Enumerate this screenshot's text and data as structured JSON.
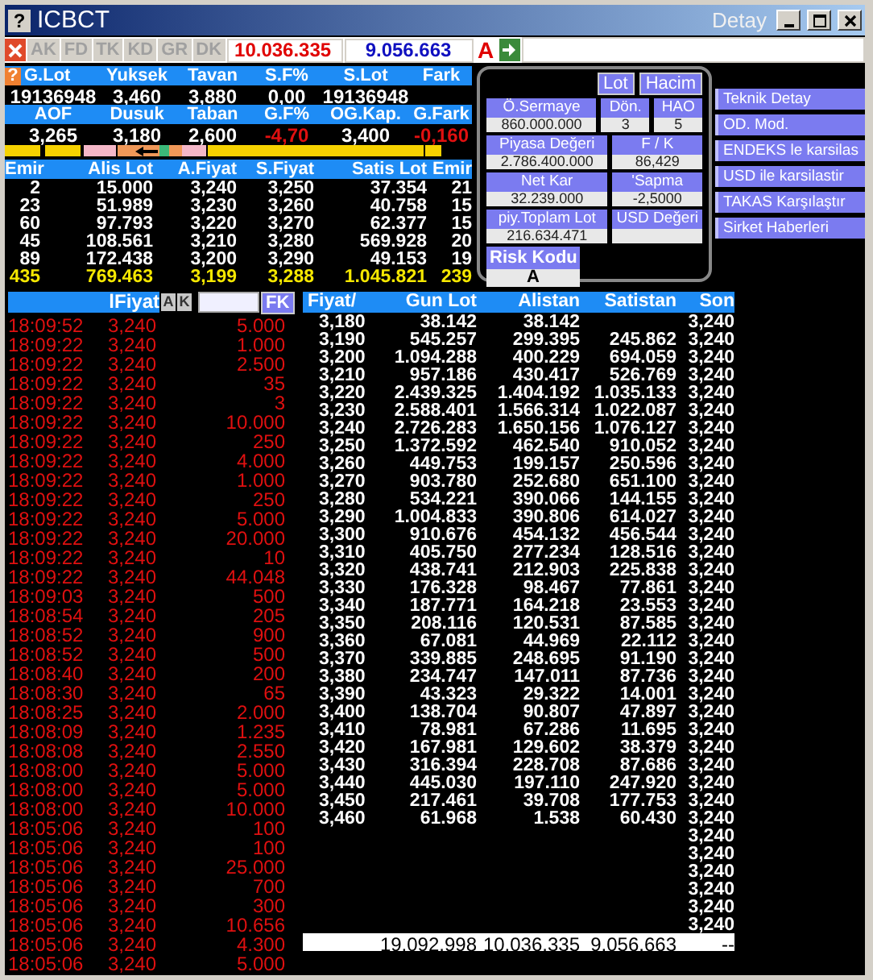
{
  "window": {
    "help": "?",
    "title": "ICBCT",
    "detay": "Detay"
  },
  "toolbar": {
    "tabs": [
      "AK",
      "FD",
      "TK",
      "KD",
      "GR",
      "DK"
    ],
    "buy_total": "10.036.335",
    "sell_total": "9.056.663",
    "flag": "A"
  },
  "summary": {
    "help": "?",
    "blocks": [
      {
        "headers": [
          "G.Lot",
          "Yuksek",
          "Tavan",
          "S.F%",
          "S.Lot",
          "Fark"
        ],
        "values": [
          {
            "text": "19136948",
            "negative": false
          },
          {
            "text": "3,460",
            "negative": false
          },
          {
            "text": "3,880",
            "negative": false
          },
          {
            "text": "0,00",
            "negative": false
          },
          {
            "text": "19136948",
            "negative": false
          }
        ]
      },
      {
        "headers": [
          "AOF",
          "Dusuk",
          "Taban",
          "G.F%",
          "OG.Kap.",
          "G.Fark"
        ],
        "values": [
          {
            "text": "3,265",
            "negative": false
          },
          {
            "text": "3,180",
            "negative": false
          },
          {
            "text": "2,600",
            "negative": false
          },
          {
            "text": "-4,70",
            "negative": true
          },
          {
            "text": "3,400",
            "negative": false
          },
          {
            "text": "-0,160",
            "negative": true
          }
        ]
      }
    ]
  },
  "depth": {
    "columns": [
      "Emir",
      "Alis Lot",
      "A.Fiyat",
      "S.Fiyat",
      "Satis Lot",
      "Emir"
    ],
    "rows": [
      [
        "2",
        "15.000",
        "3,240",
        "3,250",
        "37.354",
        "21"
      ],
      [
        "23",
        "51.989",
        "3,230",
        "3,260",
        "40.758",
        "15"
      ],
      [
        "60",
        "97.793",
        "3,220",
        "3,270",
        "62.377",
        "15"
      ],
      [
        "45",
        "108.561",
        "3,210",
        "3,280",
        "569.928",
        "20"
      ],
      [
        "89",
        "172.438",
        "3,200",
        "3,290",
        "49.153",
        "19"
      ]
    ],
    "total": [
      "435",
      "769.463",
      "3,199",
      "3,288",
      "1.045.821",
      "239"
    ]
  },
  "info_panel": {
    "toggles": [
      "Lot",
      "Hacim"
    ],
    "rows": [
      [
        {
          "label": "Ö.Sermaye",
          "value": "860.000.000"
        },
        {
          "label": "Dön.",
          "value": "3"
        },
        {
          "label": "HAO",
          "value": "5"
        }
      ],
      [
        {
          "label": "Piyasa Değeri",
          "value": "2.786.400.000"
        },
        {
          "label": "F / K",
          "value": "86,429"
        }
      ],
      [
        {
          "label": "Net Kar",
          "value": "32.239.000"
        },
        {
          "label": "'Sapma",
          "value": "-2,5000"
        }
      ],
      [
        {
          "label": "piy.Toplam Lot",
          "value": "216.634.471"
        },
        {
          "label": "USD Değeri"
        }
      ]
    ],
    "risk": {
      "label": "Risk Kodu",
      "value": "A"
    }
  },
  "actions": [
    "Teknik Detay",
    "OD. Mod.",
    "ENDEKS le karsilas",
    "USD ile karsilastir",
    "TAKAS Karşılaştır",
    "Sirket Haberleri"
  ],
  "trades": {
    "header": "lFiyat",
    "buttons": [
      "A",
      "K"
    ],
    "filter_button": "FK",
    "rows": [
      [
        "18:09:52",
        "3,240",
        "5.000"
      ],
      [
        "18:09:22",
        "3,240",
        "1.000"
      ],
      [
        "18:09:22",
        "3,240",
        "2.500"
      ],
      [
        "18:09:22",
        "3,240",
        "35"
      ],
      [
        "18:09:22",
        "3,240",
        "3"
      ],
      [
        "18:09:22",
        "3,240",
        "10.000"
      ],
      [
        "18:09:22",
        "3,240",
        "250"
      ],
      [
        "18:09:22",
        "3,240",
        "4.000"
      ],
      [
        "18:09:22",
        "3,240",
        "1.000"
      ],
      [
        "18:09:22",
        "3,240",
        "250"
      ],
      [
        "18:09:22",
        "3,240",
        "5.000"
      ],
      [
        "18:09:22",
        "3,240",
        "20.000"
      ],
      [
        "18:09:22",
        "3,240",
        "10"
      ],
      [
        "18:09:22",
        "3,240",
        "44.048"
      ],
      [
        "18:09:03",
        "3,240",
        "500"
      ],
      [
        "18:08:54",
        "3,240",
        "205"
      ],
      [
        "18:08:52",
        "3,240",
        "900"
      ],
      [
        "18:08:52",
        "3,240",
        "500"
      ],
      [
        "18:08:40",
        "3,240",
        "200"
      ],
      [
        "18:08:30",
        "3,240",
        "65"
      ],
      [
        "18:08:25",
        "3,240",
        "2.000"
      ],
      [
        "18:08:09",
        "3,240",
        "1.235"
      ],
      [
        "18:08:08",
        "3,240",
        "2.550"
      ],
      [
        "18:08:00",
        "3,240",
        "5.000"
      ],
      [
        "18:08:00",
        "3,240",
        "5.000"
      ],
      [
        "18:08:00",
        "3,240",
        "10.000"
      ],
      [
        "18:05:06",
        "3,240",
        "100"
      ],
      [
        "18:05:06",
        "3,240",
        "100"
      ],
      [
        "18:05:06",
        "3,240",
        "25.000"
      ],
      [
        "18:05:06",
        "3,240",
        "700"
      ],
      [
        "18:05:06",
        "3,240",
        "300"
      ],
      [
        "18:05:06",
        "3,240",
        "10.656"
      ],
      [
        "18:05:06",
        "3,240",
        "4.300"
      ],
      [
        "18:05:06",
        "3,240",
        "5.000"
      ]
    ]
  },
  "price_table": {
    "columns": [
      "Fiyat/",
      "Gun Lot",
      "Alistan",
      "Satistan",
      "Son"
    ],
    "rows": [
      [
        "3,180",
        "38.142",
        "38.142",
        null,
        "3,240"
      ],
      [
        "3,190",
        "545.257",
        "299.395",
        "245.862",
        "3,240"
      ],
      [
        "3,200",
        "1.094.288",
        "400.229",
        "694.059",
        "3,240"
      ],
      [
        "3,210",
        "957.186",
        "430.417",
        "526.769",
        "3,240"
      ],
      [
        "3,220",
        "2.439.325",
        "1.404.192",
        "1.035.133",
        "3,240"
      ],
      [
        "3,230",
        "2.588.401",
        "1.566.314",
        "1.022.087",
        "3,240"
      ],
      [
        "3,240",
        "2.726.283",
        "1.650.156",
        "1.076.127",
        "3,240"
      ],
      [
        "3,250",
        "1.372.592",
        "462.540",
        "910.052",
        "3,240"
      ],
      [
        "3,260",
        "449.753",
        "199.157",
        "250.596",
        "3,240"
      ],
      [
        "3,270",
        "903.780",
        "252.680",
        "651.100",
        "3,240"
      ],
      [
        "3,280",
        "534.221",
        "390.066",
        "144.155",
        "3,240"
      ],
      [
        "3,290",
        "1.004.833",
        "390.806",
        "614.027",
        "3,240"
      ],
      [
        "3,300",
        "910.676",
        "454.132",
        "456.544",
        "3,240"
      ],
      [
        "3,310",
        "405.750",
        "277.234",
        "128.516",
        "3,240"
      ],
      [
        "3,320",
        "438.741",
        "212.903",
        "225.838",
        "3,240"
      ],
      [
        "3,330",
        "176.328",
        "98.467",
        "77.861",
        "3,240"
      ],
      [
        "3,340",
        "187.771",
        "164.218",
        "23.553",
        "3,240"
      ],
      [
        "3,350",
        "208.116",
        "120.531",
        "87.585",
        "3,240"
      ],
      [
        "3,360",
        "67.081",
        "44.969",
        "22.112",
        "3,240"
      ],
      [
        "3,370",
        "339.885",
        "248.695",
        "91.190",
        "3,240"
      ],
      [
        "3,380",
        "234.747",
        "147.011",
        "87.736",
        "3,240"
      ],
      [
        "3,390",
        "43.323",
        "29.322",
        "14.001",
        "3,240"
      ],
      [
        "3,400",
        "138.704",
        "90.807",
        "47.897",
        "3,240"
      ],
      [
        "3,410",
        "78.981",
        "67.286",
        "11.695",
        "3,240"
      ],
      [
        "3,420",
        "167.981",
        "129.602",
        "38.379",
        "3,240"
      ],
      [
        "3,430",
        "316.394",
        "228.708",
        "87.686",
        "3,240"
      ],
      [
        "3,440",
        "445.030",
        "197.110",
        "247.920",
        "3,240"
      ],
      [
        "3,450",
        "217.461",
        "39.708",
        "177.753",
        "3,240"
      ],
      [
        "3,460",
        "61.968",
        "1.538",
        "60.430",
        "3,240"
      ],
      [
        null,
        null,
        null,
        null,
        "3,240"
      ],
      [
        null,
        null,
        null,
        null,
        "3,240"
      ],
      [
        null,
        null,
        null,
        null,
        "3,240"
      ],
      [
        null,
        null,
        null,
        null,
        "3,240"
      ],
      [
        null,
        null,
        null,
        null,
        "3,240"
      ],
      [
        null,
        null,
        null,
        null,
        "3,240"
      ]
    ],
    "totals": [
      "19.092.998",
      "10.036.335",
      "9.056.663",
      "--"
    ]
  }
}
